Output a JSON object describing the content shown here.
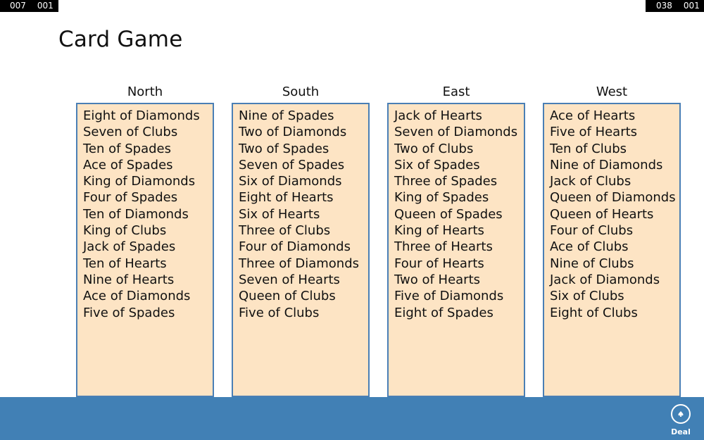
{
  "counters": {
    "left": [
      "007",
      "001"
    ],
    "right": [
      "038",
      "001"
    ]
  },
  "title": "Card Game",
  "hands": [
    {
      "name": "North",
      "cards": [
        "Eight of Diamonds",
        "Seven of Clubs",
        "Ten of Spades",
        "Ace of Spades",
        "King of Diamonds",
        "Four of Spades",
        "Ten of Diamonds",
        "King of Clubs",
        "Jack of Spades",
        "Ten of Hearts",
        "Nine of Hearts",
        "Ace of Diamonds",
        "Five of Spades"
      ]
    },
    {
      "name": "South",
      "cards": [
        "Nine of Spades",
        "Two of Diamonds",
        "Two of Spades",
        "Seven of Spades",
        "Six of Diamonds",
        "Eight of Hearts",
        "Six of Hearts",
        "Three of Clubs",
        "Four of Diamonds",
        "Three of Diamonds",
        "Seven of Hearts",
        "Queen of Clubs",
        "Five of Clubs"
      ]
    },
    {
      "name": "East",
      "cards": [
        "Jack of Hearts",
        "Seven of Diamonds",
        "Two of Clubs",
        "Six of Spades",
        "Three of Spades",
        "King of Spades",
        "Queen of Spades",
        "King of Hearts",
        "Three of Hearts",
        "Four of Hearts",
        "Two of Hearts",
        "Five of Diamonds",
        "Eight of Spades"
      ]
    },
    {
      "name": "West",
      "cards": [
        "Ace of Hearts",
        "Five of Hearts",
        "Ten of Clubs",
        "Nine of Diamonds",
        "Jack of Clubs",
        "Queen of Diamonds",
        "Queen of Hearts",
        "Four of Clubs",
        "Ace of Clubs",
        "Nine of Clubs",
        "Jack of Diamonds",
        "Six of Clubs",
        "Eight of Clubs"
      ]
    }
  ],
  "appbar": {
    "deal_label": "Deal",
    "deal_icon": "spade-icon"
  },
  "colors": {
    "panel_bg": "#fde4c4",
    "panel_border": "#4a7fb5",
    "appbar_bg": "#4180b5"
  }
}
